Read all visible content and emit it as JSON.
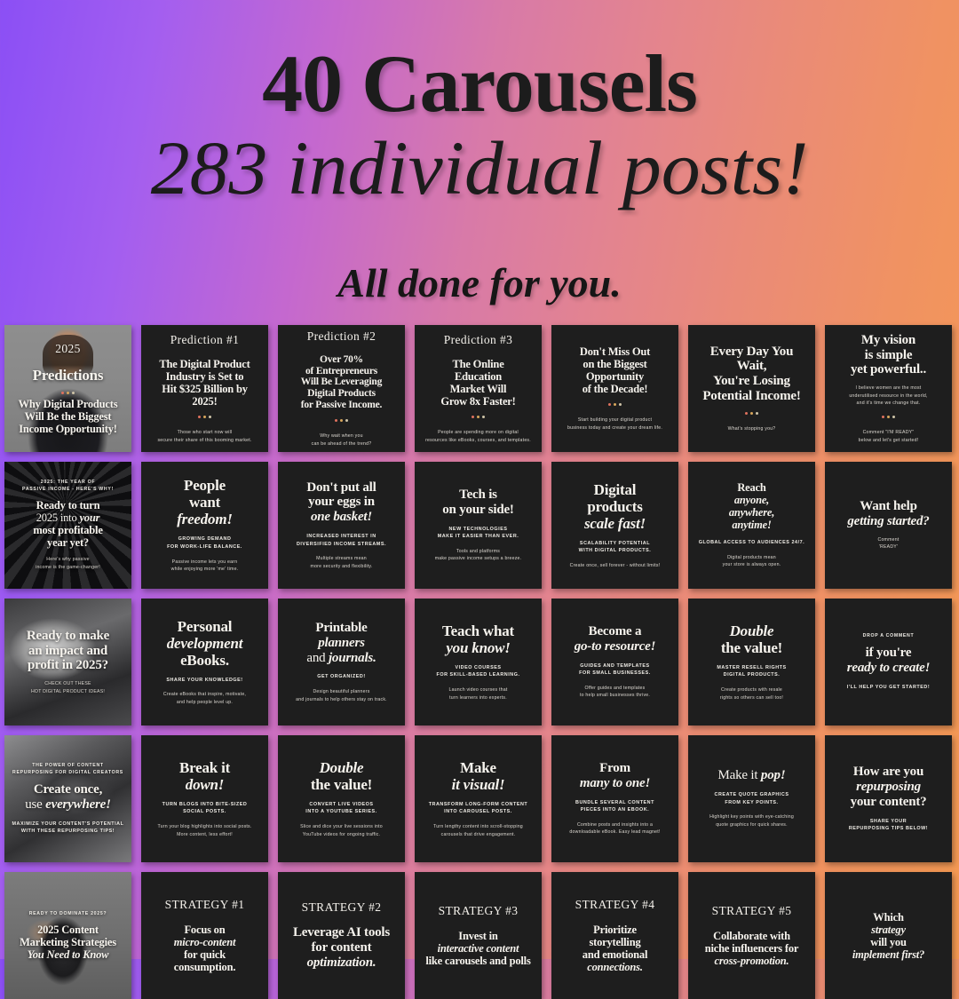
{
  "header": {
    "title": "40 Carousels",
    "subtitle": "283 individual posts!",
    "tagline": "All done for you.",
    "accent_purple": "#8b4ff5",
    "accent_orange": "#f59a52"
  },
  "dot_colors": [
    "#e0725e",
    "#d8a75c",
    "#cfc4a8"
  ],
  "tiles": [
    {
      "id": 1,
      "kind": "photo",
      "photo": "woman-in-black-portrait",
      "eyebrow": "",
      "kicker": "2025",
      "headline": "Predictions",
      "dots": true,
      "body_bold": "Why Digital Products\nWill Be the Biggest\nIncome Opportunity!",
      "sublabel": "",
      "body": ""
    },
    {
      "id": 2,
      "kind": "dark",
      "kicker": "Prediction #1",
      "headline": "The Digital Product\nIndustry is Set to\nHit $325 Billion by 2025!",
      "dots": true,
      "body": "Those who start now will\nsecure their share of this booming market."
    },
    {
      "id": 3,
      "kind": "dark",
      "kicker": "Prediction #2",
      "headline": "Over 70%\nof Entrepreneurs\nWill Be Leveraging\nDigital Products\nfor Passive Income.",
      "dots": true,
      "body": "Why wait when you\ncan be ahead of the trend?"
    },
    {
      "id": 4,
      "kind": "dark",
      "kicker": "Prediction #3",
      "headline": "The Online\nEducation\nMarket Will\nGrow 8x Faster!",
      "dots": true,
      "body": "People are spending more on digital\nresources like eBooks, courses, and templates."
    },
    {
      "id": 5,
      "kind": "dark",
      "kicker": "",
      "headline": "Don't Miss Out\non the Biggest\nOpportunity\nof the Decade!",
      "dots": true,
      "body": "Start building your digital product\nbusiness today and create your dream life."
    },
    {
      "id": 6,
      "kind": "dark",
      "kicker": "",
      "headline": "Every Day You Wait,\nYou're Losing\nPotential Income!",
      "dots": true,
      "body": "What's stopping you?"
    },
    {
      "id": 7,
      "kind": "dark",
      "kicker": "",
      "headline": "My vision\nis simple\nyet powerful..",
      "dots": true,
      "body_top": "I believe women are the most\nunderutilised resource in the world,\nand it's time we change that.",
      "body": "Comment \"I'M READY\"\nbelow and let's get started!"
    },
    {
      "id": 8,
      "kind": "photo",
      "photo": "palm-trees-dark",
      "eyebrow": "2025: THE YEAR OF\nPASSIVE INCOME - HERE'S WHY!",
      "headline": "Ready to turn\n2025 into your\nmost profitable\nyear yet?",
      "body": "Here's why passive\nincome is the game-changer!"
    },
    {
      "id": 9,
      "kind": "dark",
      "headline": "People\nwant\nfreedom!",
      "sublabel": "GROWING DEMAND\nFOR WORK-LIFE BALANCE.",
      "body": "Passive income lets you earn\nwhile enjoying more 'me' time."
    },
    {
      "id": 10,
      "kind": "dark",
      "headline": "Don't put all\nyour eggs in\none basket!",
      "sublabel": "INCREASED INTEREST IN\nDIVERSIFIED INCOME STREAMS.",
      "body": "Multiple streams mean\nmore security and flexibility."
    },
    {
      "id": 11,
      "kind": "dark",
      "headline": "Tech is\non your side!",
      "sublabel": "NEW TECHNOLOGIES\nMAKE IT EASIER THAN EVER.",
      "body": "Tools and platforms\nmake passive income setups a breeze."
    },
    {
      "id": 12,
      "kind": "dark",
      "headline": "Digital\nproducts\nscale fast!",
      "sublabel": "SCALABILITY POTENTIAL\nWITH DIGITAL PRODUCTS.",
      "body": "Create once, sell forever - without limits!"
    },
    {
      "id": 13,
      "kind": "dark",
      "headline": "Reach\nanyone,\nanywhere,\nanytime!",
      "sublabel": "GLOBAL ACCESS TO AUDIENCES 24/7.",
      "body": "Digital products mean\nyour store is always open."
    },
    {
      "id": 14,
      "kind": "dark",
      "headline": "Want help\ngetting started?",
      "body": "Comment\n'READY'"
    },
    {
      "id": 15,
      "kind": "photo",
      "photo": "laptop-desk-workspace",
      "headline": "Ready to make\nan impact and\nprofit in 2025?",
      "body": "CHECK OUT THESE\nHOT DIGITAL PRODUCT IDEAS!"
    },
    {
      "id": 16,
      "kind": "dark",
      "headline": "Personal\ndevelopment\neBooks.",
      "sublabel": "SHARE YOUR KNOWLEDGE!",
      "body": "Create eBooks that inspire, motivate,\nand help people level up."
    },
    {
      "id": 17,
      "kind": "dark",
      "headline": "Printable\nplanners\nand journals.",
      "sublabel": "GET ORGANIZED!",
      "body": "Design beautiful planners\nand journals to help others stay on track."
    },
    {
      "id": 18,
      "kind": "dark",
      "headline": "Teach what\nyou know!",
      "sublabel": "VIDEO COURSES\nFOR SKILL-BASED LEARNING.",
      "body": "Launch video courses that\nturn learners into experts."
    },
    {
      "id": 19,
      "kind": "dark",
      "headline": "Become a\ngo-to resource!",
      "sublabel": "GUIDES AND TEMPLATES\nFOR SMALL BUSINESSES.",
      "body": "Offer guides and templates\nto help small businesses thrive."
    },
    {
      "id": 20,
      "kind": "dark",
      "headline": "Double\nthe value!",
      "sublabel": "MASTER RESELL RIGHTS\nDIGITAL PRODUCTS.",
      "body": "Create products with resale\nrights so others can sell too!"
    },
    {
      "id": 21,
      "kind": "dark",
      "eyebrow": "DROP A COMMENT",
      "headline": "if you're\nready to create!",
      "sublabel": "I'LL HELP YOU GET STARTED!"
    },
    {
      "id": 22,
      "kind": "photo",
      "photo": "ballet-shoes-feet",
      "eyebrow": "THE POWER OF CONTENT\nREPURPOSING FOR DIGITAL CREATORS",
      "headline": "Create once,\nuse everywhere!",
      "sublabel": "MAXIMIZE YOUR CONTENT'S POTENTIAL\nWITH THESE REPURPOSING TIPS!"
    },
    {
      "id": 23,
      "kind": "dark",
      "headline": "Break it\ndown!",
      "sublabel": "TURN BLOGS INTO BITE-SIZED\nSOCIAL POSTS.",
      "body": "Turn your blog highlights into social posts.\nMore content, less effort!"
    },
    {
      "id": 24,
      "kind": "dark",
      "headline": "Double\nthe value!",
      "sublabel": "CONVERT LIVE VIDEOS\nINTO A YOUTUBE SERIES.",
      "body": "Slice and dice your live sessions into\nYouTube videos for ongoing traffic."
    },
    {
      "id": 25,
      "kind": "dark",
      "headline": "Make\nit visual!",
      "sublabel": "TRANSFORM LONG-FORM CONTENT\nINTO CAROUSEL POSTS.",
      "body": "Turn lengthy content into scroll-stopping\ncarousels that drive engagement."
    },
    {
      "id": 26,
      "kind": "dark",
      "headline": "From\nmany to one!",
      "sublabel": "BUNDLE SEVERAL CONTENT\nPIECES INTO AN EBOOK.",
      "body": "Combine posts and insights into a\ndownloadable eBook. Easy lead magnet!"
    },
    {
      "id": 27,
      "kind": "dark",
      "headline": "Make it pop!",
      "sublabel": "CREATE QUOTE GRAPHICS\nFROM KEY POINTS.",
      "body": "Highlight key points with eye-catching\nquote graphics for quick shares."
    },
    {
      "id": 28,
      "kind": "dark",
      "headline": "How are you\nrepurposing\nyour content?",
      "sublabel": "SHARE YOUR\nREPURPOSING TIPS BELOW!"
    },
    {
      "id": 29,
      "kind": "photo",
      "photo": "dancer-in-black-dress",
      "eyebrow": "READY TO DOMINATE 2025?",
      "headline": "2025 Content\nMarketing Strategies\nYou Need to Know"
    },
    {
      "id": 30,
      "kind": "dark",
      "kicker": "STRATEGY #1",
      "headline": "Focus on\nmicro-content\nfor quick\nconsumption."
    },
    {
      "id": 31,
      "kind": "dark",
      "kicker": "STRATEGY #2",
      "headline": "Leverage AI tools\nfor content\noptimization."
    },
    {
      "id": 32,
      "kind": "dark",
      "kicker": "STRATEGY #3",
      "headline": "Invest in\ninteractive content\nlike carousels and polls"
    },
    {
      "id": 33,
      "kind": "dark",
      "kicker": "STRATEGY #4",
      "headline": "Prioritize\nstorytelling\nand emotional\nconnections."
    },
    {
      "id": 34,
      "kind": "dark",
      "kicker": "STRATEGY #5",
      "headline": "Collaborate with\nniche influencers for\ncross-promotion."
    },
    {
      "id": 35,
      "kind": "dark",
      "headline": "Which\nstrategy\nwill you\nimplement first?"
    }
  ]
}
